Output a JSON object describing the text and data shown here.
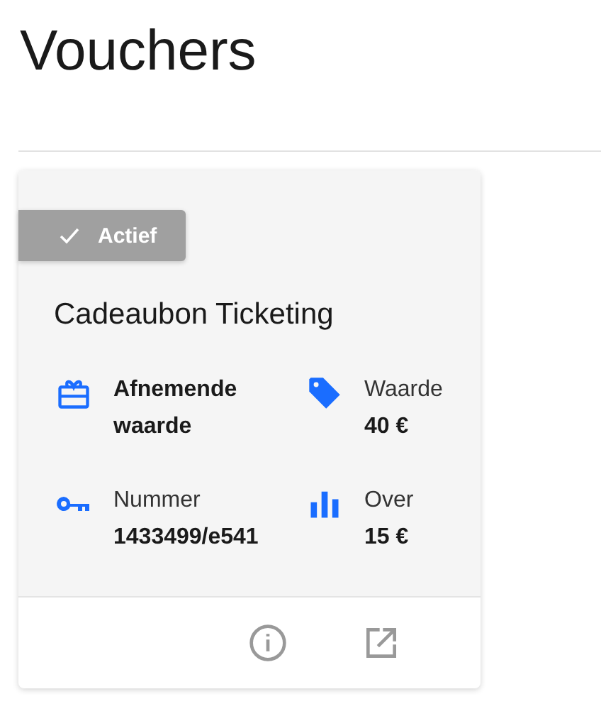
{
  "page": {
    "title": "Vouchers"
  },
  "vouchers": [
    {
      "status": {
        "label": "Actief",
        "active": true
      },
      "name": "Cadeaubon Ticketing",
      "details": [
        {
          "kind": "gift",
          "value": "Afnemende waarde"
        },
        {
          "kind": "tag",
          "label": "Waarde",
          "value": "40 €"
        },
        {
          "kind": "key",
          "label": "Nummer",
          "value": "1433499/e541"
        },
        {
          "kind": "chart",
          "label": "Over",
          "value": "15 €"
        }
      ],
      "actions": [
        {
          "kind": "info"
        },
        {
          "kind": "open"
        }
      ]
    }
  ]
}
